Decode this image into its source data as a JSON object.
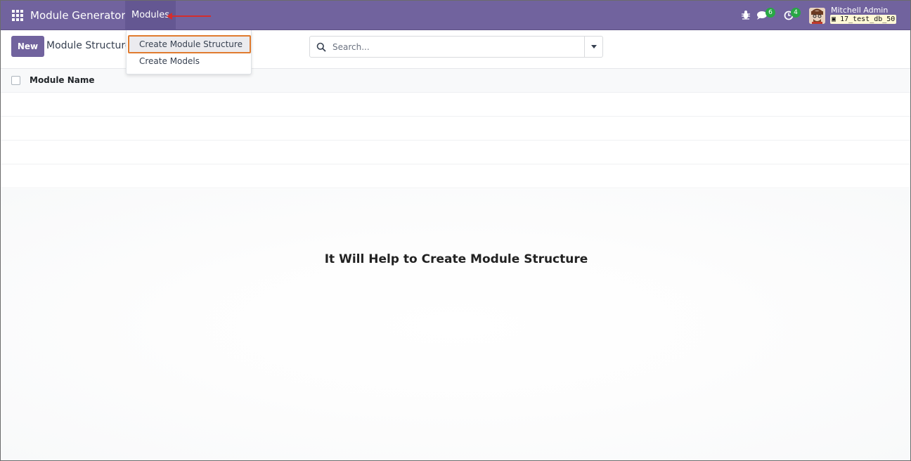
{
  "navbar": {
    "app_title": "Module Generator",
    "menu_modules": "Modules",
    "chat_count": "6",
    "activity_count": "4",
    "user_name": "Mitchell Admin",
    "db_name": "17_test_db_50",
    "color": "#71639e"
  },
  "control_panel": {
    "new_label": "New",
    "breadcrumb": "Module Structure",
    "search_placeholder": "Search..."
  },
  "dropdown": {
    "items": [
      {
        "label": "Create Module Structure",
        "highlighted": true
      },
      {
        "label": "Create Models",
        "highlighted": false
      }
    ]
  },
  "list": {
    "columns": [
      "Module Name"
    ]
  },
  "helper": {
    "title": "It Will Help to Create Module Structure"
  },
  "annotation": {
    "arrow_color": "#d42d2d",
    "highlight_color": "#e07b2f"
  }
}
